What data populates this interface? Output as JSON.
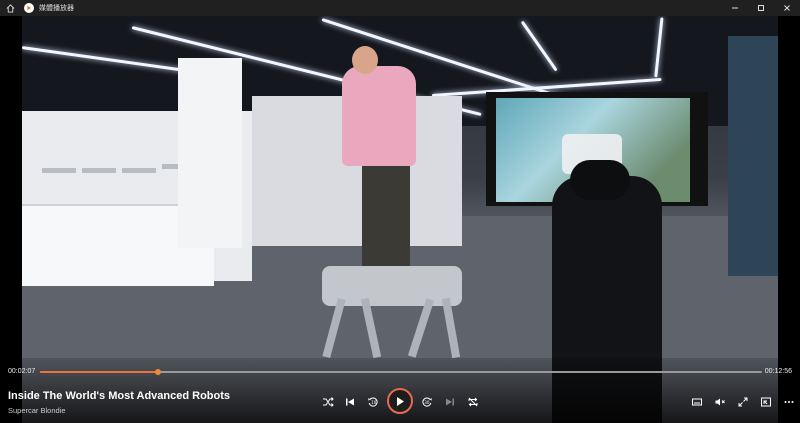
{
  "window": {
    "title": "媒體播放器",
    "icons": [
      "home-icon",
      "app-icon",
      "minimize-icon",
      "maximize-icon",
      "close-icon"
    ]
  },
  "player": {
    "current_time": "00:02:07",
    "total_time": "00:12:56",
    "progress": 0.164,
    "video_title": "Inside The World's Most Advanced Robots",
    "channel": "Supercar Blondie",
    "accent_color": "#e8763a",
    "controls_left": [
      "shuffle-icon",
      "previous-icon",
      "skip-back-10-icon",
      "play-icon",
      "skip-forward-30-icon",
      "next-icon",
      "repeat-icon"
    ],
    "controls_right": [
      "subtitles-icon",
      "volume-mute-icon",
      "fullscreen-icon",
      "mini-player-icon",
      "more-icon"
    ]
  }
}
